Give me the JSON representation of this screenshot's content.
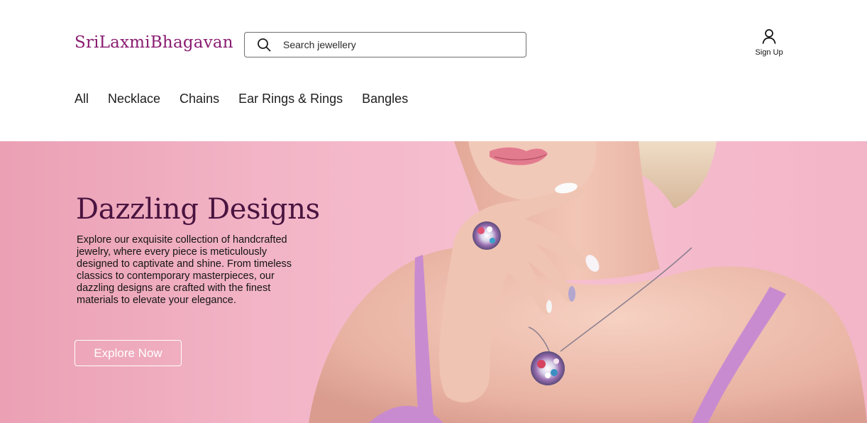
{
  "header": {
    "logo": "SriLaxmiBhagavan",
    "search": {
      "placeholder": "Search jewellery",
      "value": ""
    },
    "signup_label": "Sign Up"
  },
  "nav": {
    "items": [
      {
        "label": "All"
      },
      {
        "label": "Necklace"
      },
      {
        "label": "Chains"
      },
      {
        "label": "Ear Rings & Rings"
      },
      {
        "label": "Bangles"
      }
    ]
  },
  "hero": {
    "title": "Dazzling Designs",
    "description": "Explore our exquisite collection of handcrafted jewelry, where every piece is meticulously designed to captivate and shine. From timeless classics to contemporary masterpieces, our dazzling designs are crafted with the finest materials to elevate your elegance.",
    "button_label": "Explore Now"
  },
  "colors": {
    "brand": "#8a1d72",
    "hero_title": "#4a1440",
    "hero_background": "#f2b4c6"
  },
  "icons": {
    "search": "search-icon",
    "user": "user-icon"
  }
}
